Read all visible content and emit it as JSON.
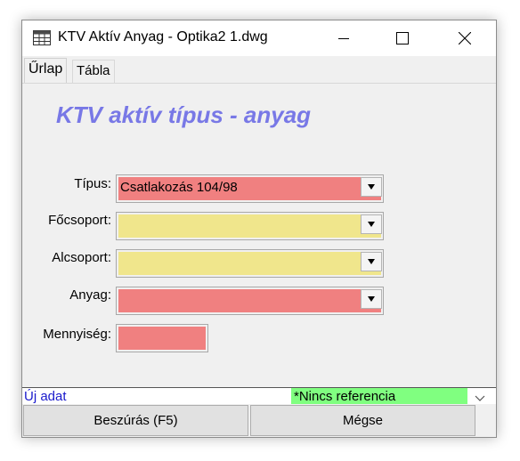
{
  "window": {
    "title": "KTV Aktív Anyag - Optika2 1.dwg",
    "icon": "table-app-icon"
  },
  "title_buttons": {
    "minimize_icon": "minimize-icon",
    "maximize_icon": "maximize-icon",
    "close_icon": "close-icon"
  },
  "tabs": [
    {
      "label": "Űrlap",
      "active": true
    },
    {
      "label": "Tábla",
      "active": false
    }
  ],
  "form": {
    "heading": "KTV aktív típus - anyag",
    "fields": [
      {
        "label": "Típus:",
        "value": "Csatlakozás 104/98",
        "color": "#f08080",
        "type": "combo"
      },
      {
        "label": "Főcsoport:",
        "value": "",
        "color": "#f0e68c",
        "type": "combo"
      },
      {
        "label": "Alcsoport:",
        "value": "",
        "color": "#f0e68c",
        "type": "combo"
      },
      {
        "label": "Anyag:",
        "value": "",
        "color": "#f08080",
        "type": "combo"
      },
      {
        "label": "Mennyiség:",
        "value": "",
        "color": "#f08080",
        "type": "text"
      }
    ]
  },
  "status": {
    "left": "Új adat",
    "reference": "*Nincs referencia",
    "reference_color": "#80ff80"
  },
  "buttons": {
    "insert_label": "Beszúrás (F5)",
    "cancel_label": "Mégse"
  }
}
